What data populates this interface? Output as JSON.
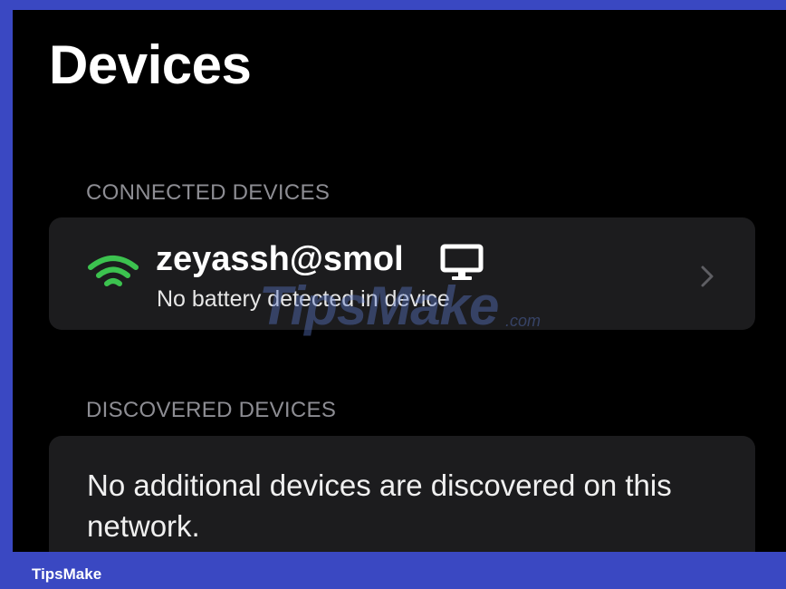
{
  "page": {
    "title": "Devices"
  },
  "connected": {
    "section_label": "CONNECTED DEVICES",
    "device": {
      "name": "zeyassh@smol",
      "subtitle": "No battery detected in device",
      "status_icon": "wifi-icon",
      "type_icon": "monitor-icon",
      "wifi_color": "#3cc24f"
    }
  },
  "discovered": {
    "section_label": "DISCOVERED DEVICES",
    "empty_message": "No additional devices are discovered on this network."
  },
  "watermark": {
    "text": "TipsMake",
    "suffix": ".com"
  },
  "footer": {
    "brand": "TipsMake",
    "bar_color": "#3a48c2"
  }
}
